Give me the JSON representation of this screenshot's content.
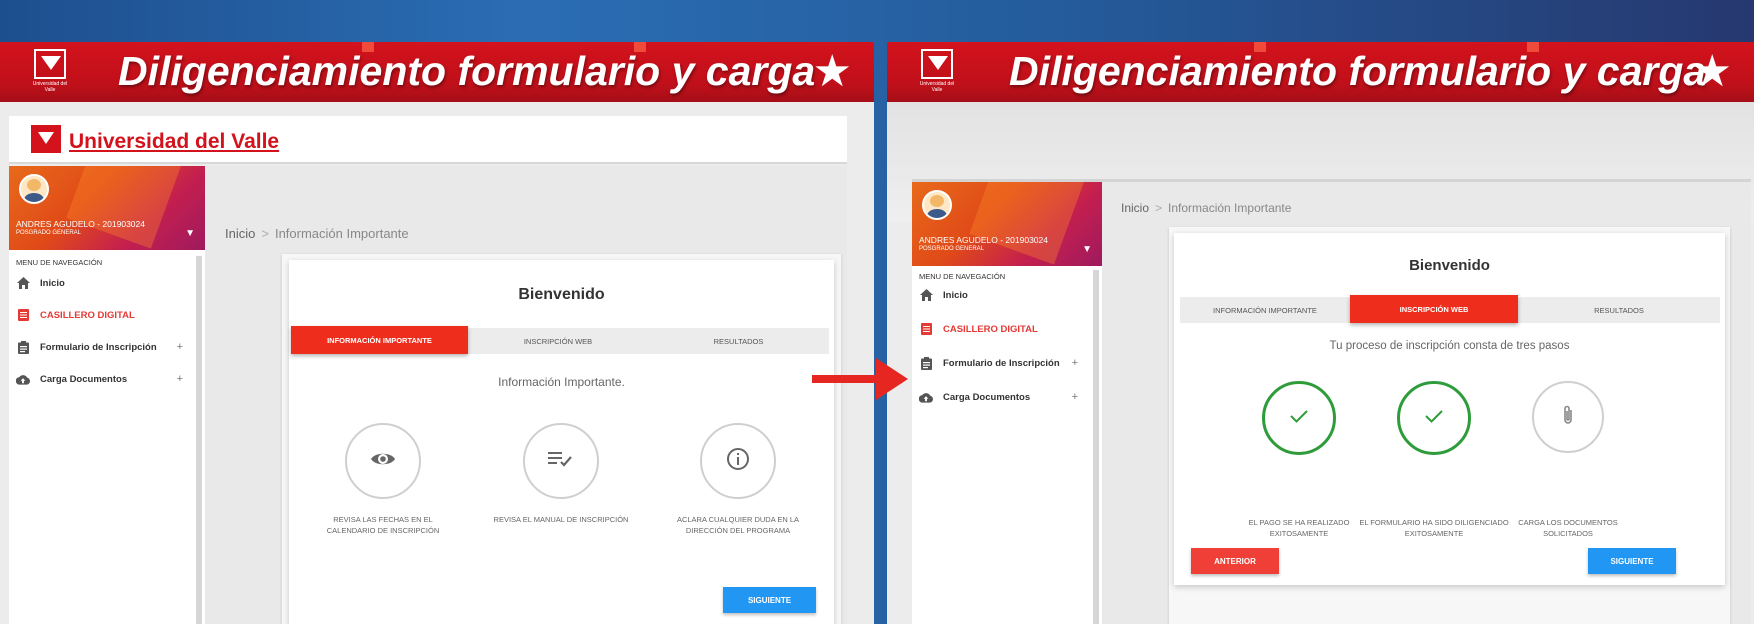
{
  "banner": {
    "title": "Diligenciamiento formulario y carga",
    "logo_caption": "Universidad del Valle",
    "star_icon": "star-icon"
  },
  "left": {
    "university_name": "Universidad del Valle",
    "profile": {
      "name": "ANDRES AGUDELO - 201903024",
      "program": "POSGRADO GENERAL"
    },
    "nav_title": "MENU DE NAVEGACIÓN",
    "nav": [
      {
        "label": "Inicio",
        "icon": "home-icon"
      },
      {
        "label": "CASILLERO DIGITAL",
        "icon": "list-icon",
        "active": true
      },
      {
        "label": "Formulario de Inscripción",
        "icon": "clipboard-icon",
        "plus": "+"
      },
      {
        "label": "Carga Documentos",
        "icon": "cloud-upload-icon",
        "plus": "+"
      }
    ],
    "breadcrumb": {
      "home": "Inicio",
      "sep": ">",
      "current": "Información Importante"
    },
    "card": {
      "title": "Bienvenido",
      "tabs": [
        "INFORMACIÓN IMPORTANTE",
        "INSCRIPCIÓN WEB",
        "RESULTADOS"
      ],
      "active_tab": 0,
      "subtitle": "Información Importante.",
      "steps": [
        {
          "icon": "eye-icon",
          "text": "REVISA LAS FECHAS EN EL CALENDARIO DE INSCRIPCIÓN"
        },
        {
          "icon": "checklist-icon",
          "text": "REVISA EL MANUAL DE INSCRIPCIÓN"
        },
        {
          "icon": "info-icon",
          "text": "ACLARA CUALQUIER DUDA EN LA DIRECCIÓN DEL PROGRAMA"
        }
      ],
      "next_label": "SIGUIENTE"
    }
  },
  "right": {
    "profile": {
      "name": "ANDRES AGUDELO - 201903024",
      "program": "POSGRADO GENERAL"
    },
    "nav_title": "MENU DE NAVEGACIÓN",
    "nav": [
      {
        "label": "Inicio",
        "icon": "home-icon"
      },
      {
        "label": "CASILLERO DIGITAL",
        "icon": "list-icon",
        "active": true
      },
      {
        "label": "Formulario de Inscripción",
        "icon": "clipboard-icon",
        "plus": "+"
      },
      {
        "label": "Carga Documentos",
        "icon": "cloud-upload-icon",
        "plus": "+"
      }
    ],
    "breadcrumb": {
      "home": "Inicio",
      "sep": ">",
      "current": "Información Importante"
    },
    "card": {
      "title": "Bienvenido",
      "tabs": [
        "INFORMACIÓN IMPORTANTE",
        "INSCRIPCIÓN WEB",
        "RESULTADOS"
      ],
      "active_tab": 1,
      "subtitle": "Tu proceso de inscripción consta de tres pasos",
      "steps": [
        {
          "icon": "check-icon",
          "done": true,
          "text": "EL PAGO SE HA REALIZADO EXITOSAMENTE"
        },
        {
          "icon": "check-icon",
          "done": true,
          "text": "EL FORMULARIO HA SIDO DILIGENCIADO EXITOSAMENTE"
        },
        {
          "icon": "paperclip-icon",
          "done": false,
          "text": "CARGA LOS DOCUMENTOS SOLICITADOS"
        }
      ],
      "prev_label": "ANTERIOR",
      "next_label": "SIGUIENTE"
    }
  },
  "colors": {
    "banner_red": "#d3121c",
    "tab_active": "#ef2d1d",
    "button_blue": "#2196f3",
    "button_red": "#ef3f36",
    "step_done": "#2e9c3a"
  }
}
